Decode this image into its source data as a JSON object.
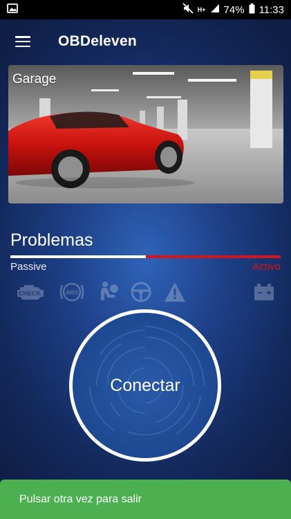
{
  "status_bar": {
    "battery": "74%",
    "time": "11:33",
    "network_type": "H+"
  },
  "app_bar": {
    "title": "OBDeleven"
  },
  "garage": {
    "label": "Garage"
  },
  "problems": {
    "title": "Problemas",
    "passive_label": "Passive",
    "active_label": "Activo",
    "icons": [
      "check-engine-icon",
      "abs-icon",
      "airbag-icon",
      "steering-icon",
      "warning-icon",
      "battery-icon"
    ]
  },
  "connect": {
    "label": "Conectar"
  },
  "toast": {
    "text": "Pulsar otra vez para salir"
  },
  "colors": {
    "accent_red": "#d7141c",
    "toast_green": "#4caf50",
    "background_blue": "#1d3f86"
  }
}
